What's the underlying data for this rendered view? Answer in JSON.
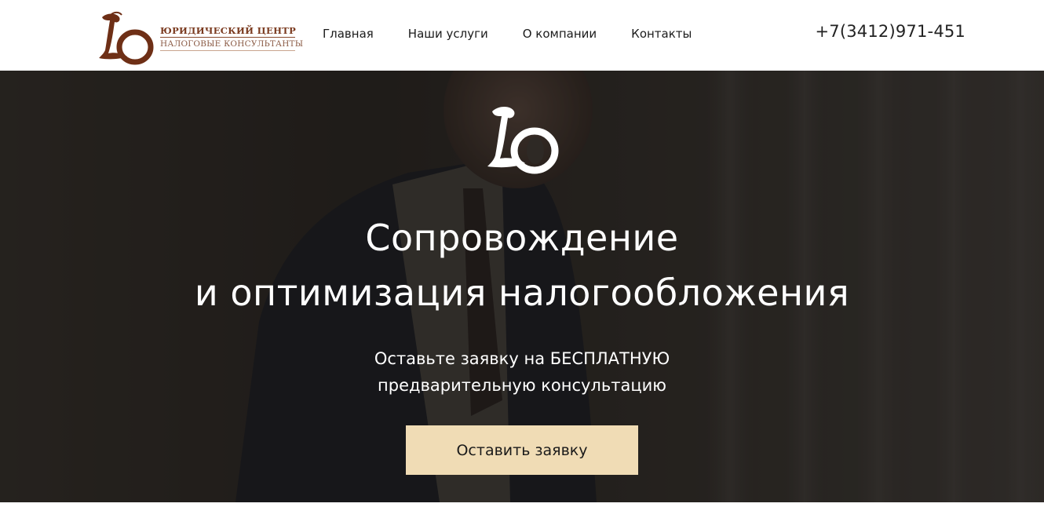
{
  "header": {
    "logo": {
      "monogram": "LO",
      "line1": "ЮРИДИЧЕСКИЙ ЦЕНТР",
      "line2": "НАЛОГОВЫЕ КОНСУЛЬТАНТЫ",
      "color": "#7a3a1f"
    },
    "nav": [
      {
        "label": "Главная"
      },
      {
        "label": "Наши услуги"
      },
      {
        "label": "О компании"
      },
      {
        "label": "Контакты"
      }
    ],
    "phone": "+7(3412)971-451"
  },
  "hero": {
    "title_line1": "Сопровождение",
    "title_line2": "и оптимизация налогообложения",
    "subtitle_line1": "Оставьте заявку на БЕСПЛАТНУЮ",
    "subtitle_line2": "предварительную консультацию",
    "cta_label": "Оставить заявку",
    "cta_color": "#f0dcb5"
  }
}
